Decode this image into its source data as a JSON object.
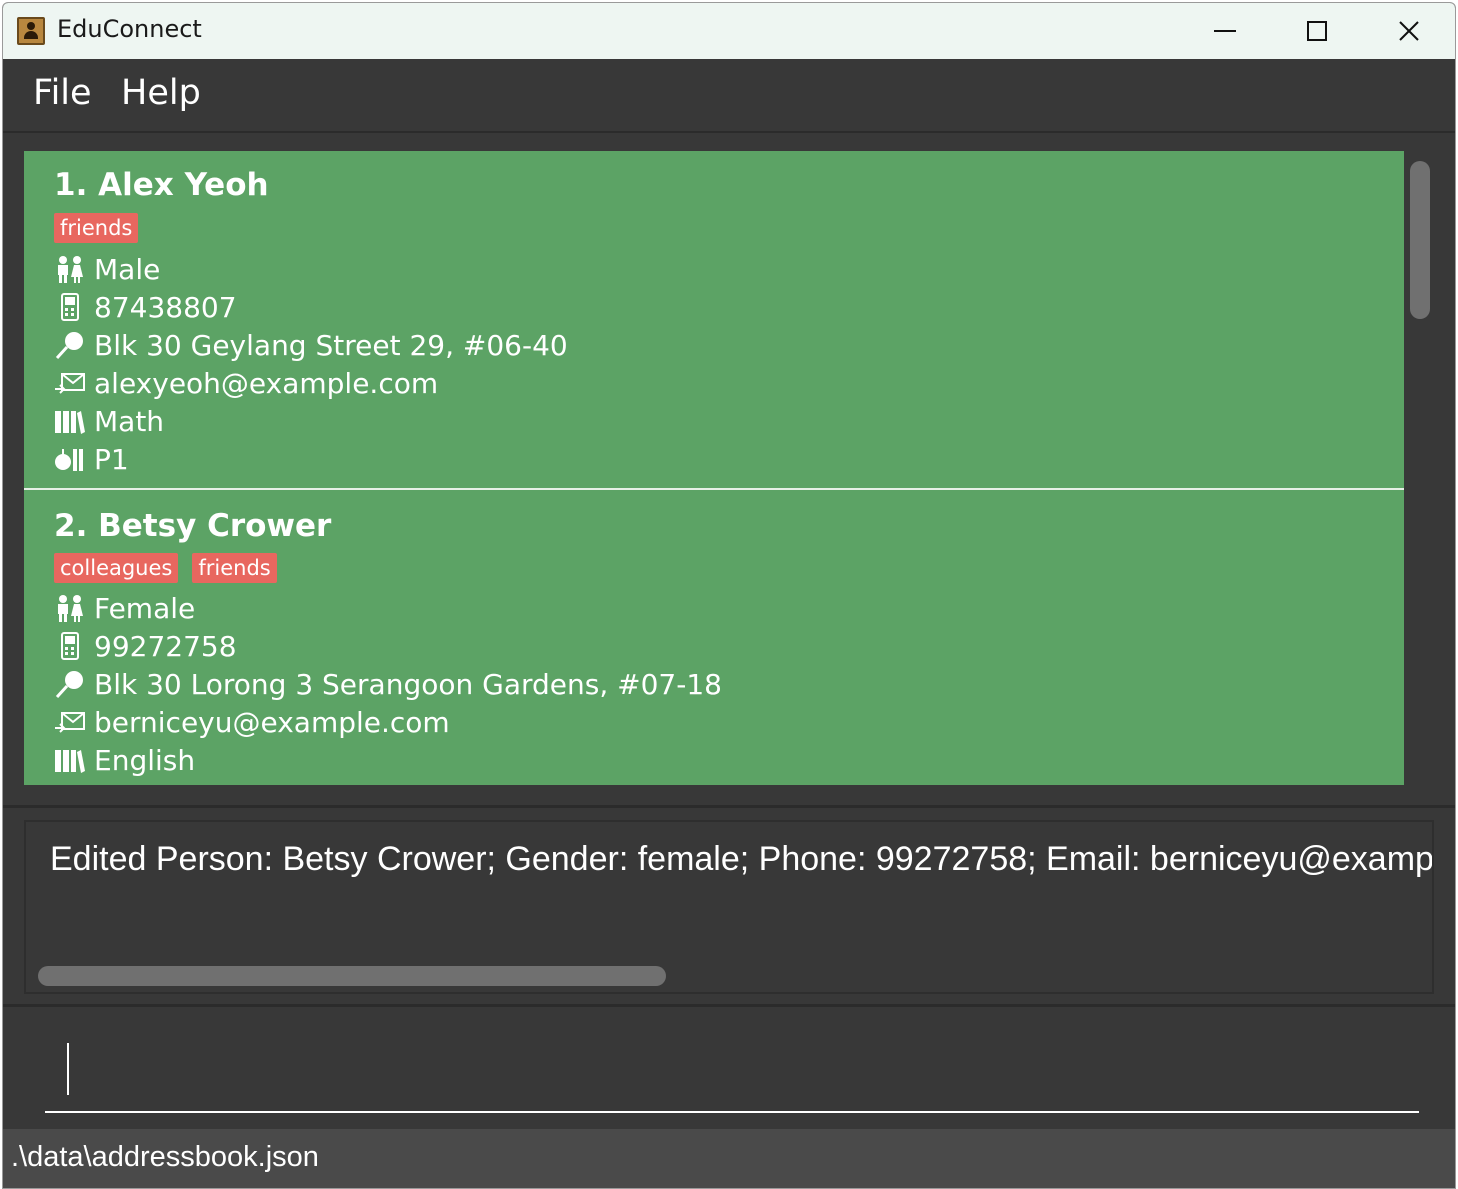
{
  "window": {
    "title": "EduConnect"
  },
  "menu": {
    "file": "File",
    "help": "Help"
  },
  "persons": [
    {
      "index_name": "1. Alex Yeoh",
      "tags": [
        "friends"
      ],
      "gender": "Male",
      "phone": "87438807",
      "address": "Blk 30 Geylang Street 29, #06-40",
      "email": "alexyeoh@example.com",
      "subject": "Math",
      "level": "P1"
    },
    {
      "index_name": "2. Betsy Crower",
      "tags": [
        "colleagues",
        "friends"
      ],
      "gender": "Female",
      "phone": "99272758",
      "address": "Blk 30 Lorong 3 Serangoon Gardens, #07-18",
      "email": "berniceyu@example.com",
      "subject": "English"
    }
  ],
  "result": {
    "text": "Edited Person: Betsy Crower; Gender: female; Phone: 99272758; Email: berniceyu@example.com"
  },
  "command": {
    "value": ""
  },
  "status": {
    "path": ".\\data\\addressbook.json"
  },
  "icons": {
    "gender": "people-icon",
    "phone": "phone-icon",
    "address": "pin-icon",
    "email": "mail-icon",
    "subject": "books-icon",
    "level": "level-icon"
  },
  "colors": {
    "card_bg": "#5ca365",
    "tag_bg": "#e8675f",
    "app_bg": "#383838"
  }
}
